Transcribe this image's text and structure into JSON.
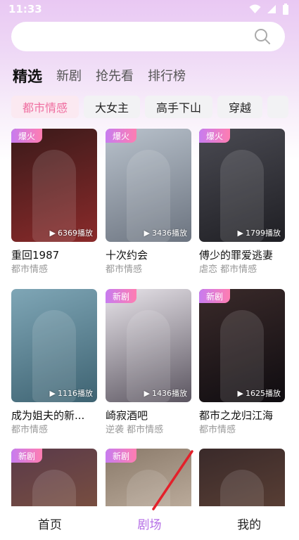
{
  "status": {
    "time": "11:33"
  },
  "search": {
    "placeholder": ""
  },
  "tabs": [
    {
      "label": "精选",
      "active": true
    },
    {
      "label": "新剧",
      "active": false
    },
    {
      "label": "抢先看",
      "active": false
    },
    {
      "label": "排行榜",
      "active": false
    }
  ],
  "chips": [
    {
      "label": "都市情感",
      "active": true
    },
    {
      "label": "大女主",
      "active": false
    },
    {
      "label": "高手下山",
      "active": false
    },
    {
      "label": "穿越",
      "active": false
    }
  ],
  "cards": [
    {
      "title": "重回1987",
      "tags": "都市情感",
      "badge": "爆火",
      "plays": "6369播放",
      "colors": [
        "#3a1a1a",
        "#8a2a2a"
      ]
    },
    {
      "title": "十次约会",
      "tags": "都市情感",
      "badge": "爆火",
      "plays": "3436播放",
      "colors": [
        "#b9c2cc",
        "#6c7480"
      ]
    },
    {
      "title": "傅少的罪爱逃妻",
      "tags": "虐恋 都市情感",
      "badge": "爆火",
      "plays": "1799播放",
      "colors": [
        "#4a4a52",
        "#1f1f24"
      ]
    },
    {
      "title": "成为姐夫的新...",
      "tags": "都市情感",
      "badge": "",
      "plays": "1116播放",
      "colors": [
        "#7fa6b6",
        "#3e6372"
      ]
    },
    {
      "title": "崎寂酒吧",
      "tags": "逆袭 都市情感",
      "badge": "新剧",
      "plays": "1436播放",
      "colors": [
        "#e8e4ea",
        "#5b5560"
      ]
    },
    {
      "title": "都市之龙归江海",
      "tags": "都市情感",
      "badge": "新剧",
      "plays": "1625播放",
      "colors": [
        "#3a2a2a",
        "#0f0c10"
      ]
    },
    {
      "title": "",
      "tags": "",
      "badge": "新剧",
      "plays": "",
      "colors": [
        "#5a3a4a",
        "#8a5a3a"
      ]
    },
    {
      "title": "",
      "tags": "",
      "badge": "新剧",
      "plays": "",
      "colors": [
        "#8a7a6a",
        "#d8c8b8"
      ]
    },
    {
      "title": "",
      "tags": "",
      "badge": "",
      "plays": "",
      "colors": [
        "#3a2a2a",
        "#6a4a3a"
      ]
    }
  ],
  "bottom_nav": [
    {
      "label": "首页",
      "active": false
    },
    {
      "label": "剧场",
      "active": true
    },
    {
      "label": "我的",
      "active": false
    }
  ],
  "colors": {
    "accent": "#b56ee6",
    "chip_active": "#ef6ea0"
  }
}
